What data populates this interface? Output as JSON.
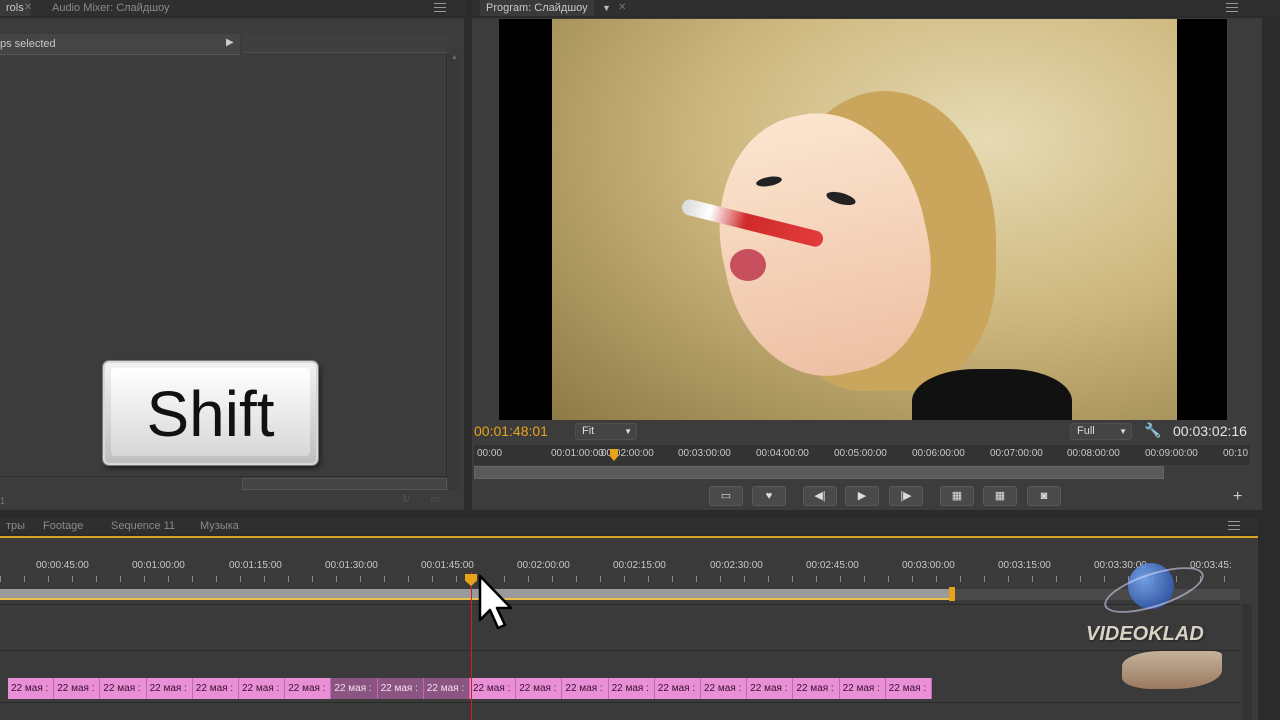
{
  "left_panel": {
    "tabs": [
      "rols",
      "Audio Mixer: Слайдшоу"
    ],
    "clips_selected": "ps selected",
    "bottom_label": "1",
    "shift_key": "Shift"
  },
  "program": {
    "tab": "Program: Слайдшоу",
    "current_time": "00:01:48:01",
    "zoom": "Fit",
    "resolution": "Full",
    "duration": "00:03:02:16",
    "ruler": [
      "00:00",
      "00:01:00:00",
      "00:02:00:00",
      "00:03:00:00",
      "00:04:00:00",
      "00:05:00:00",
      "00:06:00:00",
      "00:07:00:00",
      "00:08:00:00",
      "00:09:00:00",
      "00:10"
    ],
    "playhead_fraction": 0.18
  },
  "timeline": {
    "tabs": [
      "тры",
      "Footage",
      "Sequence 11",
      "Музыка"
    ],
    "ruler": [
      "00:00:45:00",
      "00:01:00:00",
      "00:01:15:00",
      "00:01:30:00",
      "00:01:45:00",
      "00:02:00:00",
      "00:02:15:00",
      "00:02:30:00",
      "00:02:45:00",
      "00:03:00:00",
      "00:03:15:00",
      "00:03:30:00",
      "00:03:45:"
    ],
    "clip_label": "22 мая :",
    "clip_count": 20
  },
  "watermark": "VIDEOKLAD",
  "colors": {
    "timecode": "#e8a419",
    "clip": "#e98fd6",
    "clip_selected": "#8a5681",
    "work_area": "#e8c04a",
    "playhead": "#d02020"
  }
}
